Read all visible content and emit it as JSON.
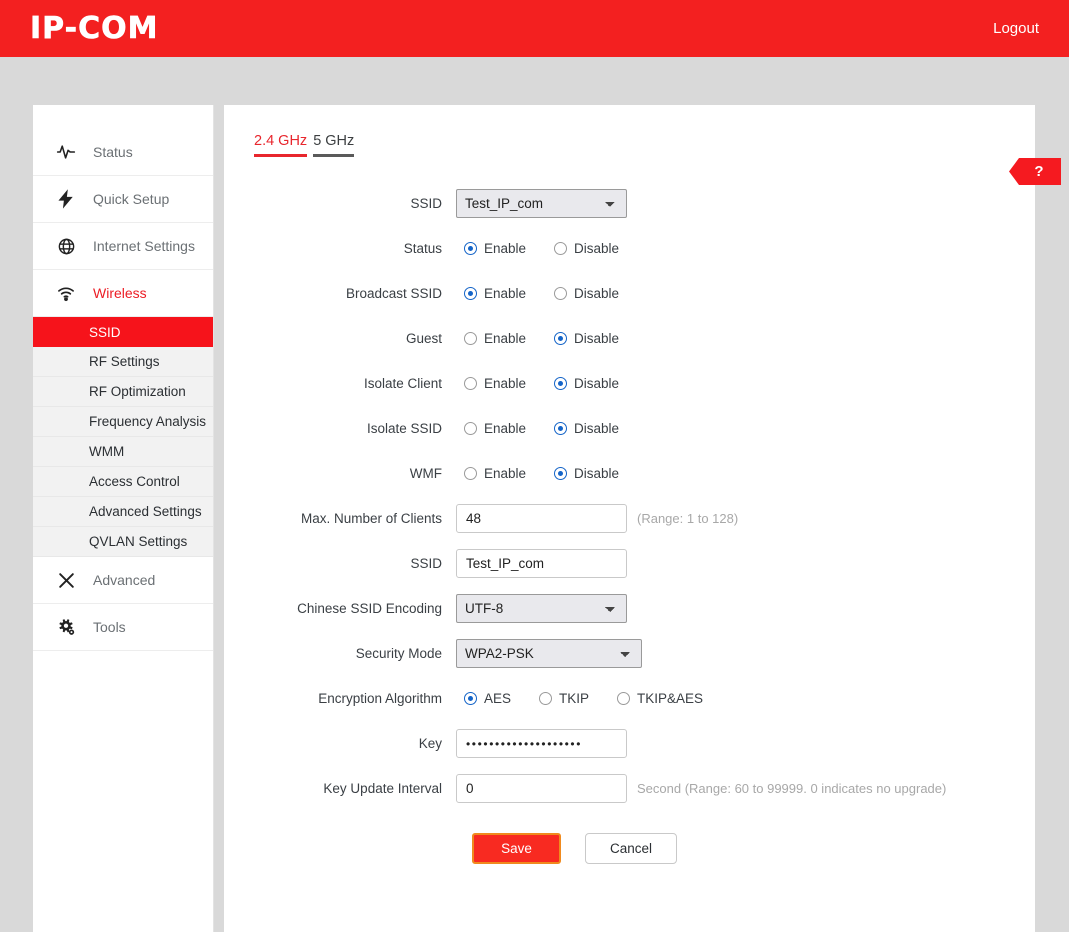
{
  "header": {
    "logo": "IP-COM",
    "logout_label": "Logout",
    "brand_color": "#f32020"
  },
  "sidebar": {
    "items": [
      {
        "label": "Status",
        "icon": "pulse-icon"
      },
      {
        "label": "Quick Setup",
        "icon": "bolt-icon"
      },
      {
        "label": "Internet Settings",
        "icon": "globe-icon"
      },
      {
        "label": "Wireless",
        "icon": "wifi-icon",
        "active": true
      },
      {
        "label": "Advanced",
        "icon": "tools-icon"
      },
      {
        "label": "Tools",
        "icon": "gears-icon"
      }
    ],
    "submenu": [
      {
        "label": "SSID",
        "selected": true
      },
      {
        "label": "RF Settings"
      },
      {
        "label": "RF Optimization"
      },
      {
        "label": "Frequency Analysis"
      },
      {
        "label": "WMM"
      },
      {
        "label": "Access Control"
      },
      {
        "label": "Advanced Settings"
      },
      {
        "label": "QVLAN Settings"
      }
    ],
    "active_color": "#ec1c24",
    "selected_bg": "#f6131b"
  },
  "main": {
    "tabs": [
      {
        "label": "2.4 GHz",
        "active": true
      },
      {
        "label": "5 GHz",
        "active": false
      }
    ],
    "help_badge": "?",
    "form": {
      "ssid_select_label": "SSID",
      "ssid_select_value": "Test_IP_com",
      "ssid_select_options": [
        "Test_IP_com"
      ],
      "status_label": "Status",
      "status_enable": "Enable",
      "status_disable": "Disable",
      "broadcast_label": "Broadcast SSID",
      "broadcast_enable": "Enable",
      "broadcast_disable": "Disable",
      "guest_label": "Guest",
      "guest_enable": "Enable",
      "guest_disable": "Disable",
      "isolate_client_label": "Isolate Client",
      "isolate_client_enable": "Enable",
      "isolate_client_disable": "Disable",
      "isolate_ssid_label": "Isolate SSID",
      "isolate_ssid_enable": "Enable",
      "isolate_ssid_disable": "Disable",
      "wmf_label": "WMF",
      "wmf_enable": "Enable",
      "wmf_disable": "Disable",
      "max_clients_label": "Max. Number of Clients",
      "max_clients_value": "48",
      "max_clients_hint": "(Range: 1 to 128)",
      "ssid_text_label": "SSID",
      "ssid_text_value": "Test_IP_com",
      "encoding_label": "Chinese SSID Encoding",
      "encoding_value": "UTF-8",
      "encoding_options": [
        "UTF-8"
      ],
      "security_label": "Security Mode",
      "security_value": "WPA2-PSK",
      "security_options": [
        "WPA2-PSK"
      ],
      "encryption_label": "Encryption Algorithm",
      "encryption_aes": "AES",
      "encryption_tkip": "TKIP",
      "encryption_tkipaes": "TKIP&AES",
      "key_label": "Key",
      "key_value": "••••••••••••••••••••",
      "key_interval_label": "Key Update Interval",
      "key_interval_value": "0",
      "key_interval_hint": "Second (Range: 60 to 99999. 0 indicates no upgrade)"
    },
    "save_label": "Save",
    "cancel_label": "Cancel"
  }
}
